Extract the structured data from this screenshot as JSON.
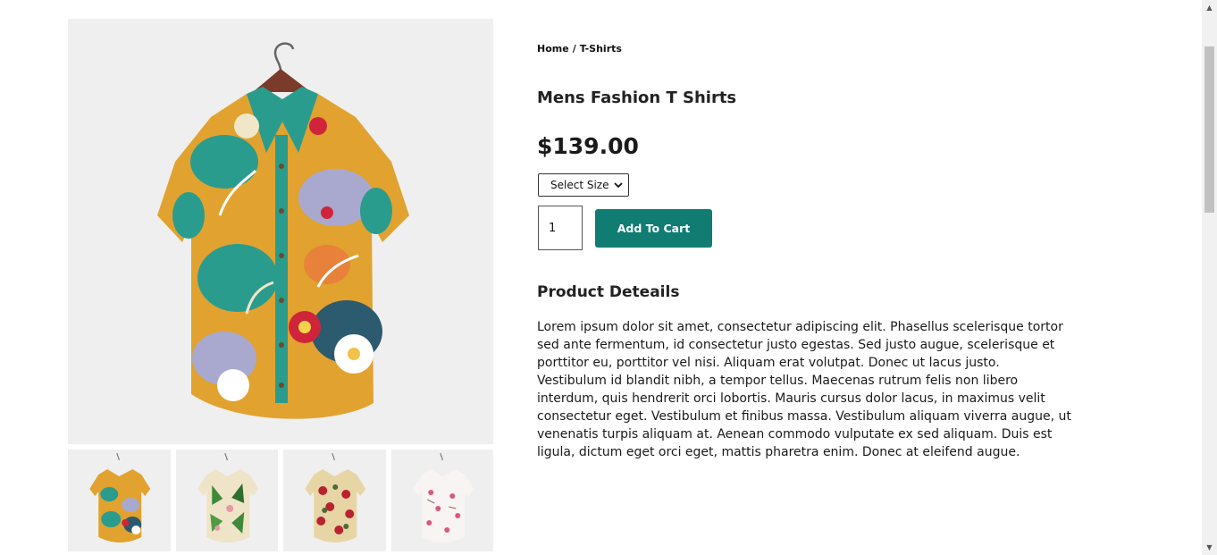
{
  "breadcrumb": {
    "home": "Home",
    "separator": "/",
    "current": "T-Shirts"
  },
  "product": {
    "title": "Mens Fashion T Shirts",
    "price": "$139.00",
    "size_select": {
      "selected": "Select Size",
      "icon": "chevron-down-icon"
    },
    "quantity": "1",
    "add_to_cart_label": "Add To Cart",
    "details_heading": "Product Deteails",
    "details_text": "Lorem ipsum dolor sit amet, consectetur adipiscing elit. Phasellus scelerisque tortor sed ante fermentum, id consectetur justo egestas. Sed justo augue, scelerisque et porttitor eu, porttitor vel nisi. Aliquam erat volutpat. Donec ut lacus justo. Vestibulum id blandit nibh, a tempor tellus. Maecenas rutrum felis non libero interdum, quis hendrerit orci lobortis. Mauris cursus dolor lacus, in maximus velit consectetur eget. Vestibulum et finibus massa. Vestibulum aliquam viverra augue, ut venenatis turpis aliquam at. Aenean commodo vulputate ex sed aliquam. Duis est ligula, dictum eget orci eget, mattis pharetra enim. Donec at eleifend augue."
  },
  "gallery": {
    "thumbnails": [
      {
        "name": "colorful-abstract-shirt"
      },
      {
        "name": "green-tropical-leaf-shirt"
      },
      {
        "name": "red-floral-shirt"
      },
      {
        "name": "white-pink-floral-shirt"
      }
    ]
  },
  "colors": {
    "accent_button": "#107c72",
    "image_background": "#efefef"
  }
}
